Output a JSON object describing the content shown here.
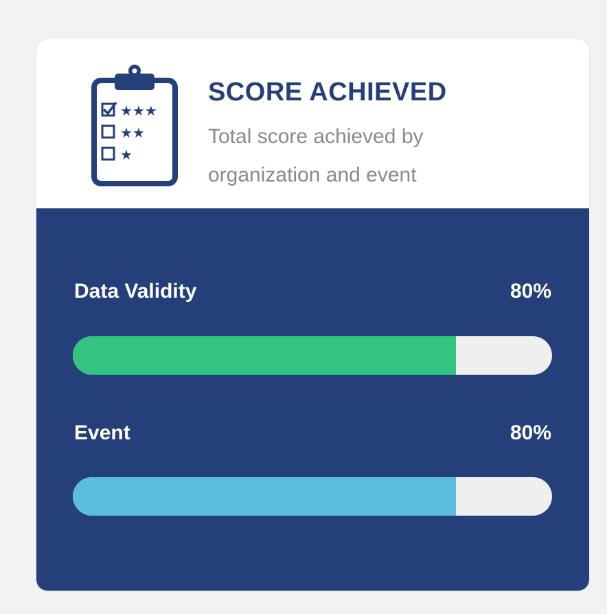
{
  "card": {
    "title": "SCORE ACHIEVED",
    "description": "Total score achieved by organization and event",
    "icon": "clipboard-rating-icon"
  },
  "metrics": [
    {
      "label": "Data Validity",
      "value_text": "80%",
      "fraction": 0.8,
      "color": "#33c57f"
    },
    {
      "label": "Event",
      "value_text": "80%",
      "fraction": 0.8,
      "color": "#5bbde0"
    }
  ],
  "colors": {
    "primary": "#243f7a",
    "track": "#efefef",
    "description": "#8a8a8a"
  }
}
